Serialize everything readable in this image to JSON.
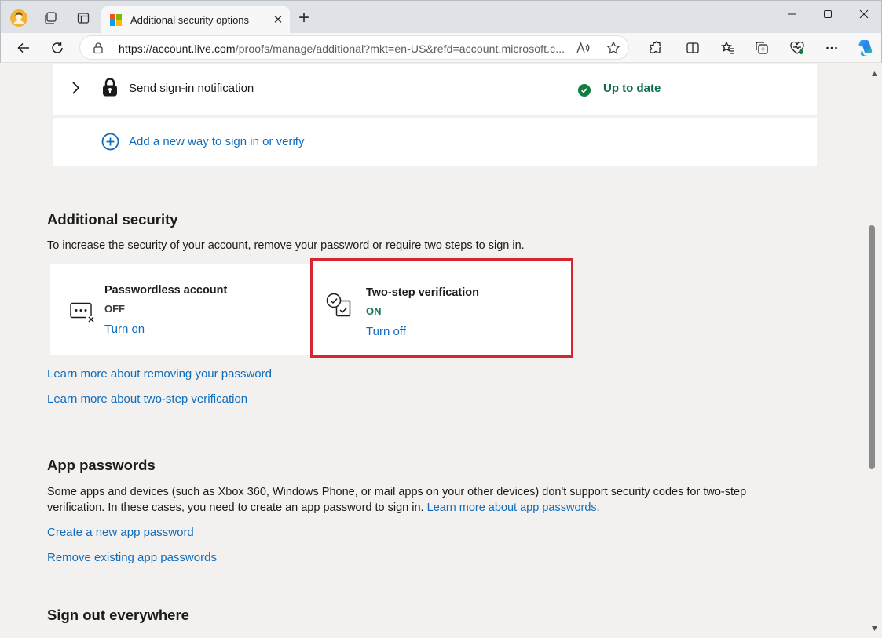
{
  "browser": {
    "tab_title": "Additional security options",
    "tab_close": "✕",
    "new_tab": "+",
    "url_host": "https://account.live.com",
    "url_rest": "/proofs/manage/additional?mkt=en-US&refd=account.microsoft.c...",
    "colors": {
      "tabbar": "#dfe3e8",
      "toolbar": "#f7f7f7"
    }
  },
  "signin_notification": {
    "label": "Send sign-in notification",
    "status": "Up to date"
  },
  "add_method": {
    "label": "Add a new way to sign in or verify"
  },
  "additional_security": {
    "heading": "Additional security",
    "description": "To increase the security of your account, remove your password or require two steps to sign in.",
    "passwordless": {
      "title": "Passwordless account",
      "state": "OFF",
      "action": "Turn on"
    },
    "two_step": {
      "title": "Two-step verification",
      "state": "ON",
      "action": "Turn off"
    },
    "learn_removing": "Learn more about removing your password",
    "learn_two_step": "Learn more about two-step verification"
  },
  "app_passwords": {
    "heading": "App passwords",
    "line1": "Some apps and devices (such as Xbox 360, Windows Phone, or mail apps on your other devices) don't support security codes for two-step",
    "line2_text": "verification. In these cases, you need to create an app password to sign in.",
    "line2_link": "Learn more about app passwords",
    "line2_end": ".",
    "create": "Create a new app password",
    "remove": "Remove existing app passwords"
  },
  "sign_out": {
    "heading": "Sign out everywhere"
  },
  "colors": {
    "page_bg": "#f2f1ef",
    "link": "#0f6cbd",
    "success": "#107c41",
    "on_state": "#0e7a5a",
    "highlight": "#d72630"
  }
}
